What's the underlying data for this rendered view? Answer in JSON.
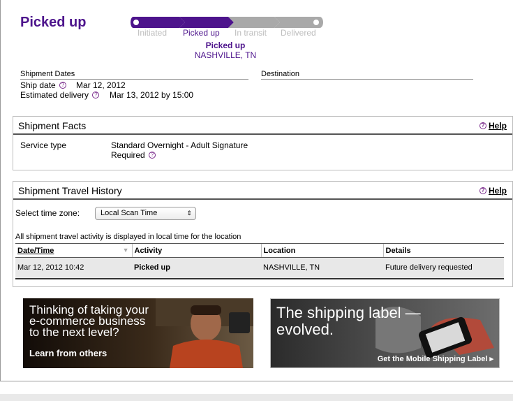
{
  "status": {
    "title": "Picked up",
    "steps": [
      "Initiated",
      "Picked up",
      "In transit",
      "Delivered"
    ],
    "current_step_index": 1,
    "current_status": "Picked up",
    "current_location": "NASHVILLE, TN"
  },
  "dates": {
    "section_label": "Shipment Dates",
    "destination_label": "Destination",
    "ship_date_label": "Ship date",
    "ship_date_value": "Mar 12, 2012",
    "estimated_label": "Estimated delivery",
    "estimated_value": "Mar 13, 2012 by 15:00"
  },
  "facts": {
    "title": "Shipment Facts",
    "help": "Help",
    "service_type_label": "Service type",
    "service_type_value_line1": "Standard Overnight - Adult Signature",
    "service_type_value_line2": "Required"
  },
  "history": {
    "title": "Shipment Travel History",
    "help": "Help",
    "timezone_label": "Select time zone:",
    "timezone_value": "Local Scan Time",
    "note": "All shipment travel activity is displayed in local time for the location",
    "columns": [
      "Date/Time",
      "Activity",
      "Location",
      "Details"
    ],
    "rows": [
      [
        "Mar 12, 2012 10:42",
        "Picked up",
        "NASHVILLE, TN",
        "Future delivery requested"
      ]
    ]
  },
  "promos": {
    "left_line1": "Thinking of taking your",
    "left_line2": "e-commerce business",
    "left_line3": "to the next level?",
    "left_cta": "Learn from others",
    "right_line1": "The shipping label —",
    "right_line2": "evolved.",
    "right_cta": "Get the Mobile Shipping Label ▸"
  },
  "colors": {
    "brand_purple": "#4d148c",
    "inactive_gray": "#bdbdbd"
  }
}
